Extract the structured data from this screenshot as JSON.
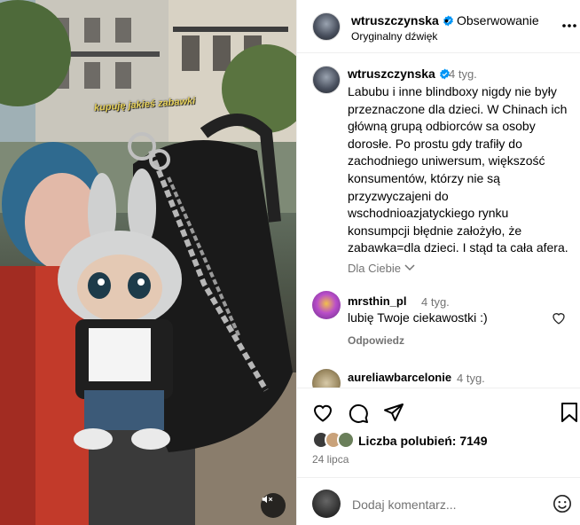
{
  "media": {
    "overlay_caption": "kupuję jakieś zabawki",
    "mute_icon": "speaker-muted-icon"
  },
  "header": {
    "username": "wtruszczynska",
    "separator": "•",
    "follow_status": "Obserwowanie",
    "audio": "Oryginalny dźwięk",
    "more_icon": "more-horizontal-icon"
  },
  "caption": {
    "username": "wtruszczynska",
    "time": "4 tyg.",
    "text": "Labubu i inne blindboxy nigdy nie były przeznaczone dla dzieci. W Chinach ich główną grupą odbiorców sa osoby dorosłe. Po prostu gdy trafiły do zachodniego uniwersum, większość konsumentów, którzy nie są przyzwyczajeni do wschodnioazjatyckiego rynku konsumpcji błędnie założyło, że zabawka=dla dzieci. I stąd ta cała afera.",
    "for_you": "Dla Ciebie"
  },
  "comments": [
    {
      "username": "mrsthin_pl",
      "time": "4 tyg.",
      "text": "lubię Twoje ciekawostki :)",
      "reply": "Odpowiedz"
    },
    {
      "username": "aureliawbarcelonie",
      "time": "4 tyg."
    }
  ],
  "actions": {
    "likes_label": "Liczba polubień:",
    "likes_count": "7149",
    "date": "24 lipca"
  },
  "add_comment": {
    "placeholder": "Dodaj komentarz..."
  },
  "colors": {
    "verified": "#0095f6",
    "muted_text": "#737373",
    "border": "#efefef",
    "overlay_text": "#e8d25a"
  }
}
